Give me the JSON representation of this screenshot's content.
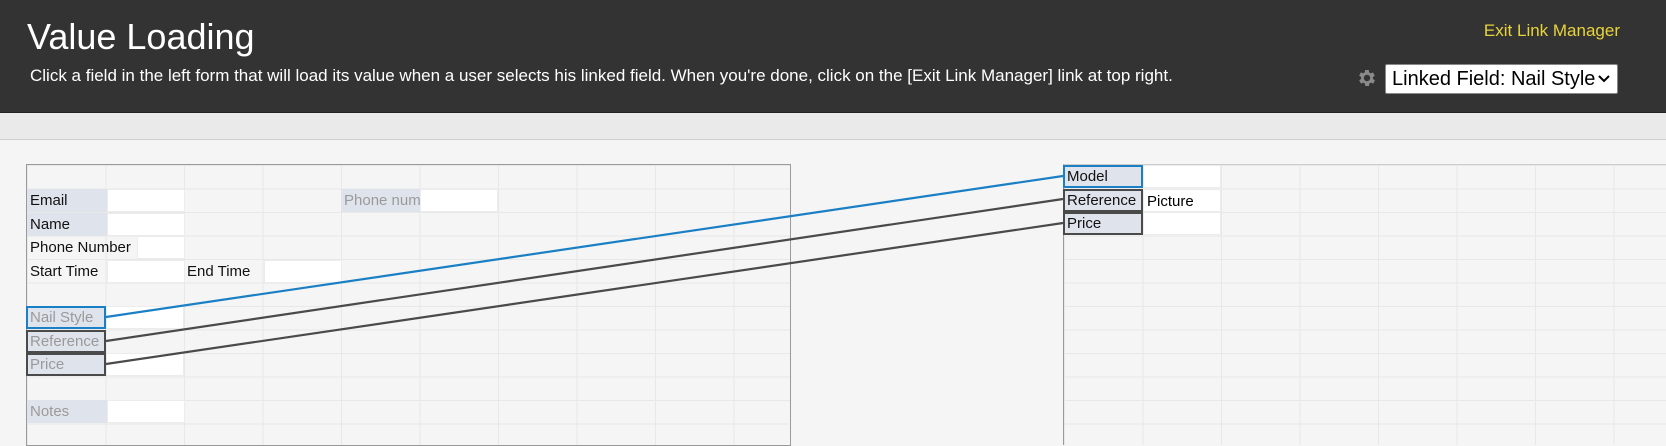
{
  "header": {
    "title": "Value Loading",
    "instructions": "Click a field in the left form that will load its value when a user selects his linked field. When you're done, click on the [Exit Link Manager] link at top right.",
    "exit_link": "Exit Link Manager",
    "settings_icon": "gear-icon",
    "linked_field_select": {
      "selected": "Linked Field: Nail Style"
    }
  },
  "left_form": {
    "fields": {
      "email": "Email",
      "phone_placeholder": "Phone numb",
      "name": "Name",
      "phone_number": "Phone Number",
      "start_time": "Start Time",
      "end_time": "End Time",
      "nail_style": "Nail Style",
      "reference": "Reference",
      "price": "Price",
      "notes": "Notes"
    }
  },
  "right_form": {
    "fields": {
      "model": "Model",
      "reference": "Reference",
      "reference_value": "Picture",
      "price": "Price"
    }
  },
  "colors": {
    "header_bg": "#333333",
    "exit_link": "#e8d33b",
    "selected_link": "#1a7fc4",
    "other_link": "#4a4a4a"
  }
}
